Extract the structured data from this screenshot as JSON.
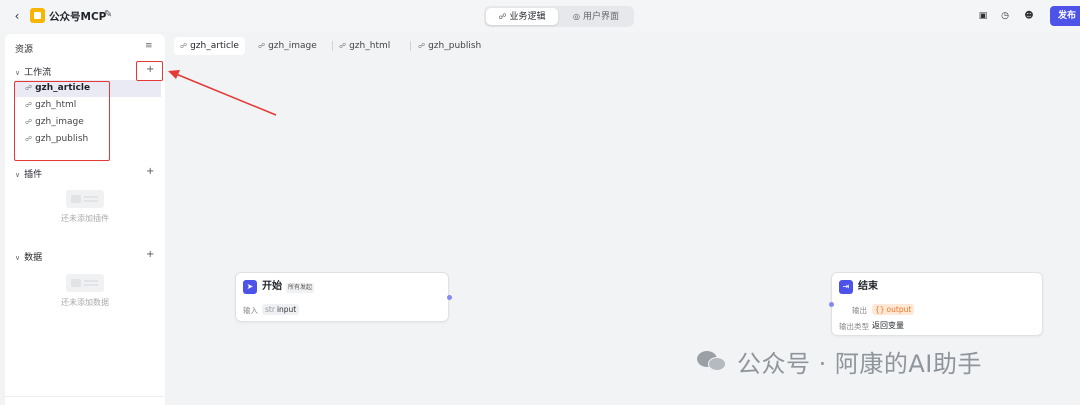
{
  "topbar": {
    "back_icon": "chevron-left-icon",
    "app_title": "公众号MCP",
    "edit_icon": "edit-icon",
    "segments": [
      {
        "label": "业务逻辑",
        "icon": "flow-icon",
        "active": true
      },
      {
        "label": "用户界面",
        "icon": "palette-icon",
        "active": false
      }
    ],
    "tools": [
      "screen-icon",
      "history-icon",
      "users-icon"
    ],
    "publish_label": "发布",
    "accent": "#4d53e8"
  },
  "sidebar": {
    "title": "资源",
    "workflow": {
      "label": "工作流",
      "items": [
        "gzh_article",
        "gzh_html",
        "gzh_image",
        "gzh_publish"
      ],
      "active": "gzh_article"
    },
    "plugins": {
      "label": "插件",
      "empty_text": "还未添加插件"
    },
    "data": {
      "label": "数据",
      "empty_text": "还未添加数据"
    }
  },
  "tabs": [
    "gzh_article",
    "gzh_image",
    "gzh_html",
    "gzh_publish"
  ],
  "nodes": {
    "start": {
      "title": "开始",
      "badge": "所有发起",
      "input_label": "输入",
      "input_type": "str",
      "input_name": "input"
    },
    "end": {
      "title": "结束",
      "output_label": "输出",
      "output_type": "{}",
      "output_name": "output",
      "output_kind_label": "输出类型",
      "output_kind_value": "返回变量"
    }
  },
  "watermark": {
    "text": "公众号 · 阿康的AI助手"
  }
}
